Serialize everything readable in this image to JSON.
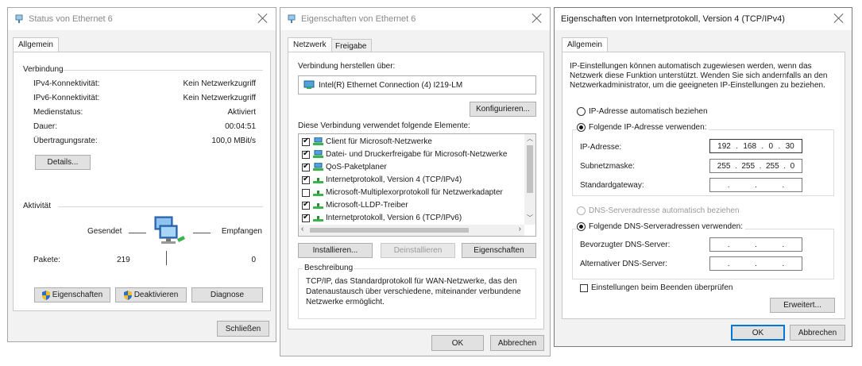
{
  "status_window": {
    "title": "Status von Ethernet 6",
    "tab": "Allgemein",
    "connection": {
      "heading": "Verbindung",
      "rows": [
        {
          "label": "IPv4-Konnektivität:",
          "value": "Kein Netzwerkzugriff"
        },
        {
          "label": "IPv6-Konnektivität:",
          "value": "Kein Netzwerkzugriff"
        },
        {
          "label": "Medienstatus:",
          "value": "Aktiviert"
        },
        {
          "label": "Dauer:",
          "value": "00:04:51"
        },
        {
          "label": "Übertragungsrate:",
          "value": "100,0 MBit/s"
        }
      ],
      "details_button": "Details..."
    },
    "activity": {
      "heading": "Aktivität",
      "sent_label": "Gesendet",
      "received_label": "Empfangen",
      "packets_label": "Pakete:",
      "packets_sent": "219",
      "packets_received": "0"
    },
    "buttons": {
      "properties": "Eigenschaften",
      "disable": "Deaktivieren",
      "diagnose": "Diagnose",
      "close": "Schließen"
    }
  },
  "properties_window": {
    "title": "Eigenschaften von Ethernet 6",
    "tabs": [
      "Netzwerk",
      "Freigabe"
    ],
    "connect_using_label": "Verbindung herstellen über:",
    "adapter": "Intel(R) Ethernet Connection (4) I219-LM",
    "configure_button": "Konfigurieren...",
    "items_label": "Diese Verbindung verwendet folgende Elemente:",
    "items": [
      {
        "label": "Client für Microsoft-Netzwerke",
        "checked": true,
        "icon": "network-client-icon"
      },
      {
        "label": "Datei- und Druckerfreigabe für Microsoft-Netzwerke",
        "checked": true,
        "icon": "network-client-icon"
      },
      {
        "label": "QoS-Paketplaner",
        "checked": true,
        "icon": "network-client-icon"
      },
      {
        "label": "Internetprotokoll, Version 4 (TCP/IPv4)",
        "checked": true,
        "icon": "protocol-icon"
      },
      {
        "label": "Microsoft-Multiplexorprotokoll für Netzwerkadapter",
        "checked": false,
        "icon": "protocol-icon"
      },
      {
        "label": "Microsoft-LLDP-Treiber",
        "checked": true,
        "icon": "protocol-icon"
      },
      {
        "label": "Internetprotokoll, Version 6 (TCP/IPv6)",
        "checked": true,
        "icon": "protocol-icon"
      }
    ],
    "install_button": "Installieren...",
    "uninstall_button": "Deinstallieren",
    "properties_button": "Eigenschaften",
    "description_heading": "Beschreibung",
    "description_lines": [
      "TCP/IP, das Standardprotokoll für WAN-Netzwerke, das den",
      "Datenaustausch über verschiedene, miteinander verbundene",
      "Netzwerke ermöglicht."
    ],
    "ok_button": "OK",
    "cancel_button": "Abbrechen"
  },
  "ipv4_window": {
    "title": "Eigenschaften von Internetprotokoll, Version 4 (TCP/IPv4)",
    "tab": "Allgemein",
    "intro_lines": [
      "IP-Einstellungen können automatisch zugewiesen werden, wenn das",
      "Netzwerk diese Funktion unterstützt. Wenden Sie sich andernfalls an den",
      "Netzwerkadministrator, um die geeigneten IP-Einstellungen zu beziehen."
    ],
    "radio_auto_ip": "IP-Adresse automatisch beziehen",
    "radio_manual_ip": "Folgende IP-Adresse verwenden:",
    "ip_label": "IP-Adresse:",
    "ip_value": [
      "192",
      "168",
      "0",
      "30"
    ],
    "subnet_label": "Subnetzmaske:",
    "subnet_value": [
      "255",
      "255",
      "255",
      "0"
    ],
    "gateway_label": "Standardgateway:",
    "radio_auto_dns": "DNS-Serveradresse automatisch beziehen",
    "radio_manual_dns": "Folgende DNS-Serveradressen verwenden:",
    "preferred_dns_label": "Bevorzugter DNS-Server:",
    "alternate_dns_label": "Alternativer DNS-Server:",
    "validate_checkbox": "Einstellungen beim Beenden überprüfen",
    "advanced_button": "Erweitert...",
    "ok_button": "OK",
    "cancel_button": "Abbrechen"
  }
}
